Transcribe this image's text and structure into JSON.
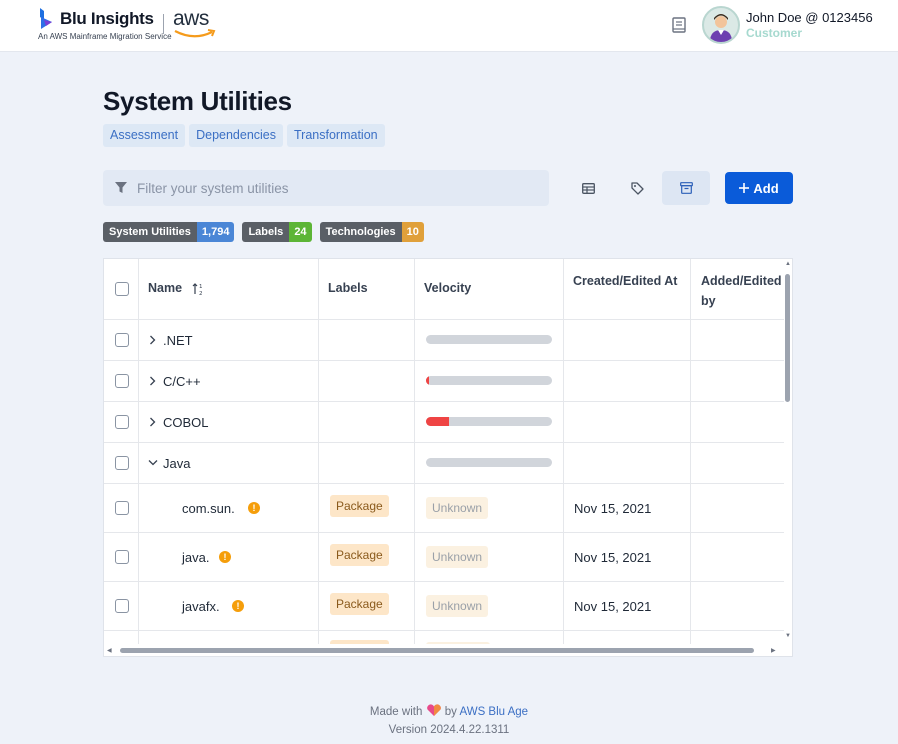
{
  "header": {
    "brand_name": "Blu Insights",
    "brand_subtitle": "An AWS Mainframe Migration Service",
    "partner_logo_text": "aws",
    "user_name": "John Doe @ 0123456",
    "user_role": "Customer",
    "icons": {
      "docs": "book-icon",
      "avatar": "user-avatar-icon"
    }
  },
  "page": {
    "title": "System Utilities",
    "tabs": [
      "Assessment",
      "Dependencies",
      "Transformation"
    ]
  },
  "toolbar": {
    "filter_placeholder": "Filter your system utilities",
    "add_label": "Add",
    "icons": [
      "table-view-icon",
      "tag-icon",
      "archive-icon"
    ],
    "active_tool": "archive-icon"
  },
  "badges": [
    {
      "label": "System Utilities",
      "count": "1,794",
      "color": "#4a86d6"
    },
    {
      "label": "Labels",
      "count": "24",
      "color": "#5cb536"
    },
    {
      "label": "Technologies",
      "count": "10",
      "color": "#e0a03a"
    }
  ],
  "table": {
    "columns": [
      "Name",
      "Labels",
      "Velocity",
      "Created/Edited At",
      "Added/Edited by"
    ],
    "rows": [
      {
        "name": "‎.NET",
        "type": "group",
        "expanded": false,
        "velocity": 0
      },
      {
        "name": "C/C++",
        "type": "group",
        "expanded": false,
        "velocity": 0.02
      },
      {
        "name": "COBOL",
        "type": "group",
        "expanded": false,
        "velocity": 0.18
      },
      {
        "name": "Java",
        "type": "group",
        "expanded": true,
        "velocity": 0
      },
      {
        "name": "com.sun.",
        "type": "item",
        "warning": true,
        "label": "Package",
        "velocity_text": "Unknown",
        "created": "Nov 15, 2021"
      },
      {
        "name": "java.",
        "type": "item",
        "warning": true,
        "label": "Package",
        "velocity_text": "Unknown",
        "created": "Nov 15, 2021"
      },
      {
        "name": "javafx.",
        "type": "item",
        "warning": true,
        "label": "Package",
        "velocity_text": "Unknown",
        "created": "Nov 15, 2021"
      }
    ]
  },
  "footer": {
    "made_with": "Made with",
    "by": "by",
    "link": "AWS Blu Age",
    "version": "Version 2024.4.22.1311"
  },
  "colors": {
    "primary": "#0a5bd9",
    "warning": "#f59e0b",
    "velocity_fill": "#ef4444"
  }
}
